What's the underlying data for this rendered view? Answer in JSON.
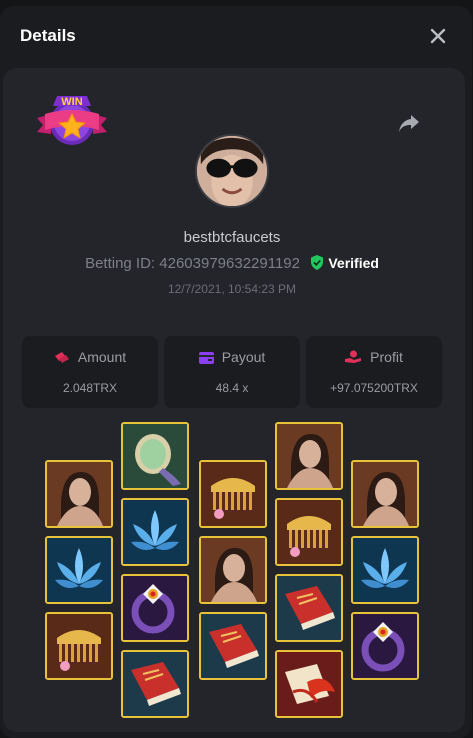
{
  "modal": {
    "title": "Details"
  },
  "bet": {
    "username": "bestbtcfaucets",
    "betting_id_label": "Betting ID:",
    "betting_id": "42603979632291192",
    "verified": "Verified",
    "timestamp": "12/7/2021, 10:54:23 PM"
  },
  "badge": {
    "text": "WIN"
  },
  "stats": {
    "amount_label": "Amount",
    "amount_value": "2.048TRX",
    "payout_label": "Payout",
    "payout_value": "48.4 x",
    "profit_label": "Profit",
    "profit_value": "+97.075200TRX"
  },
  "colors": {
    "accent_gold": "#e8c33a",
    "verified_green": "#22c55e",
    "stat_icon_red": "#e0315a",
    "stat_icon_purple": "#8a3ff0"
  },
  "reels": [
    {
      "column": 1,
      "symbols": [
        "woman",
        "lotus",
        "comb"
      ]
    },
    {
      "column": 2,
      "symbols": [
        "mirror",
        "lotus",
        "ring",
        "book"
      ]
    },
    {
      "column": 3,
      "symbols": [
        "comb",
        "woman",
        "book"
      ]
    },
    {
      "column": 4,
      "symbols": [
        "woman",
        "comb",
        "book",
        "fan"
      ]
    },
    {
      "column": 5,
      "symbols": [
        "woman",
        "lotus",
        "ring"
      ]
    }
  ]
}
